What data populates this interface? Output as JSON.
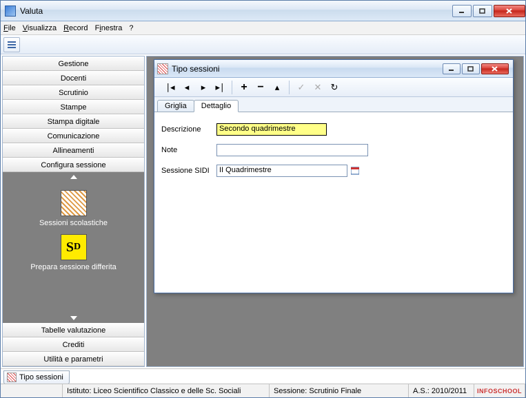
{
  "window": {
    "title": "Valuta"
  },
  "menubar": {
    "file": "File",
    "visualizza": "Visualizza",
    "record": "Record",
    "finestra": "Finestra",
    "help": "?"
  },
  "sidebar": {
    "top_buttons": [
      "Gestione",
      "Docenti",
      "Scrutinio",
      "Stampe",
      "Stampa digitale",
      "Comunicazione",
      "Allineamenti",
      "Configura sessione"
    ],
    "panel_items": [
      {
        "icon": "calendar",
        "label": "Sessioni scolastiche"
      },
      {
        "icon": "sd",
        "label": "Prepara sessione differita"
      }
    ],
    "bottom_buttons": [
      "Tabelle valutazione",
      "Crediti",
      "Utilità e parametri"
    ]
  },
  "child_window": {
    "title": "Tipo sessioni",
    "tabs": {
      "griglia": "Griglia",
      "dettaglio": "Dettaglio"
    },
    "form": {
      "descrizione_label": "Descrizione",
      "descrizione_value": "Secondo quadrimestre",
      "note_label": "Note",
      "note_value": "",
      "sidi_label": "Sessione SIDI",
      "sidi_value": "II Quadrimestre"
    },
    "nav_buttons": [
      "first",
      "prev",
      "next",
      "last",
      "add",
      "remove",
      "up",
      "apply",
      "cancel",
      "refresh"
    ]
  },
  "tasktab": {
    "label": "Tipo sessioni"
  },
  "statusbar": {
    "istituto": "Istituto: Liceo Scientifico Classico e delle Sc. Sociali",
    "sessione": "Sessione: Scrutinio Finale",
    "anno": "A.S.: 2010/2011",
    "brand": "INFOSCHOOL"
  }
}
